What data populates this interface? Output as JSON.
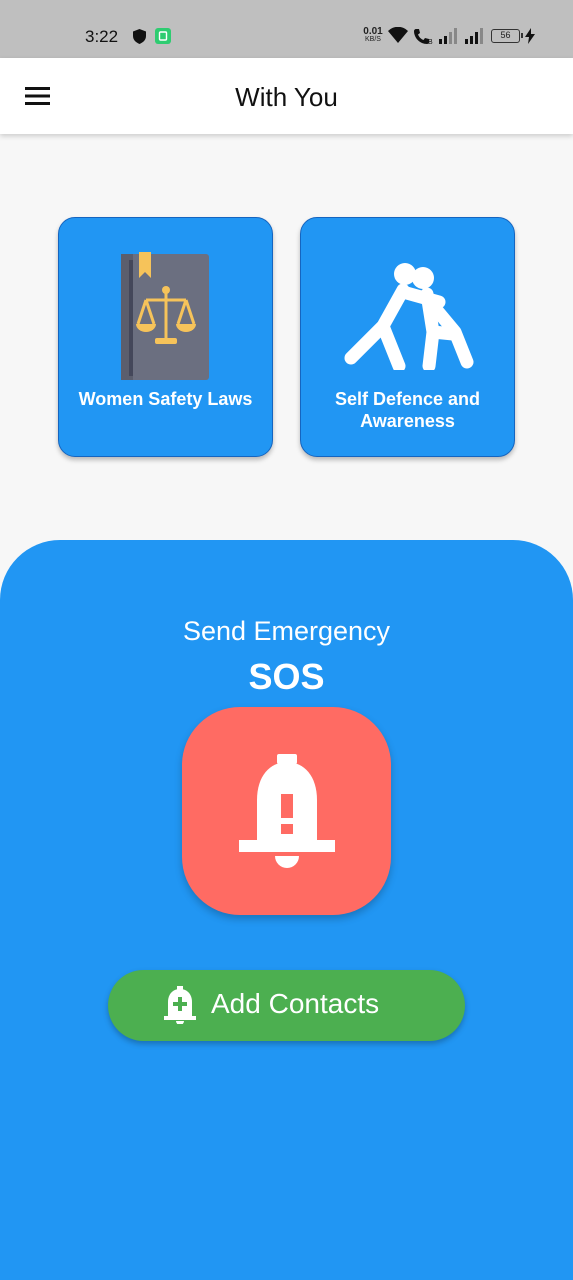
{
  "status_bar": {
    "time": "3:22",
    "net_speed_value": "0.01",
    "net_speed_unit": "KB/S",
    "battery_level": "56",
    "icons": [
      "shield-icon",
      "app-notification-icon",
      "wifi-icon",
      "wifi-calling-icon",
      "signal-icon",
      "signal-icon",
      "battery-icon",
      "charging-icon"
    ]
  },
  "app_bar": {
    "title": "With You",
    "menu_icon": "hamburger-menu-icon"
  },
  "cards": [
    {
      "label": "Women Safety Laws",
      "icon": "law-book-scales-icon"
    },
    {
      "label": "Self Defence and Awareness",
      "icon": "self-defence-icon"
    }
  ],
  "emergency": {
    "send_label": "Send Emergency",
    "sos_label": "SOS",
    "sos_icon": "alarm-bell-icon",
    "add_contacts_label": "Add Contacts",
    "add_contacts_icon": "add-alert-icon"
  },
  "colors": {
    "primary_blue": "#2196f3",
    "sos_red": "#ff6b63",
    "add_green": "#4caf50",
    "status_bar_gray": "#bfbfbf"
  }
}
